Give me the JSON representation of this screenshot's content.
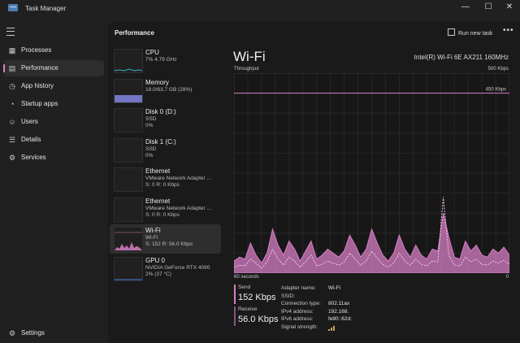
{
  "window": {
    "title": "Task Manager",
    "controls": [
      "—",
      "☐",
      "✕"
    ]
  },
  "nav": {
    "items": [
      {
        "label": "Processes",
        "icon": "processes-icon",
        "glyph": "▦",
        "active": false
      },
      {
        "label": "Performance",
        "icon": "performance-icon",
        "glyph": "▤",
        "active": true
      },
      {
        "label": "App history",
        "icon": "app-history-icon",
        "glyph": "◷",
        "active": false
      },
      {
        "label": "Startup apps",
        "icon": "startup-apps-icon",
        "glyph": "◔",
        "active": false
      },
      {
        "label": "Users",
        "icon": "users-icon",
        "glyph": "☺",
        "active": false
      },
      {
        "label": "Details",
        "icon": "details-icon",
        "glyph": "☰",
        "active": false
      },
      {
        "label": "Services",
        "icon": "services-icon",
        "glyph": "⚙",
        "active": false
      }
    ],
    "settings": {
      "label": "Settings",
      "glyph": "⚙"
    }
  },
  "performance": {
    "title": "Performance",
    "run_new_task": "Run new task",
    "more": "•••",
    "devices": [
      {
        "name": "CPU",
        "sub1": "7% 4.79 GHz",
        "sub2": "",
        "sub3": "",
        "thumb_color": "#2fb3c4",
        "active": false
      },
      {
        "name": "Memory",
        "sub1": "18.0/63.7 GB (28%)",
        "sub2": "",
        "sub3": "",
        "thumb_color": "#7d7fd6",
        "active": false
      },
      {
        "name": "Disk 0 (D:)",
        "sub1": "SSD",
        "sub2": "0%",
        "sub3": "",
        "thumb_color": "#68b04a",
        "active": false
      },
      {
        "name": "Disk 1 (C:)",
        "sub1": "SSD",
        "sub2": "0%",
        "sub3": "",
        "thumb_color": "#68b04a",
        "active": false
      },
      {
        "name": "Ethernet",
        "sub1": "VMware Network Adapter ...",
        "sub2": "S: 0 R: 0 Kbps",
        "sub3": "",
        "thumb_color": "#c88a2d",
        "active": false
      },
      {
        "name": "Ethernet",
        "sub1": "VMware Network Adapter ...",
        "sub2": "S: 0 R: 0 Kbps",
        "sub3": "",
        "thumb_color": "#c88a2d",
        "active": false
      },
      {
        "name": "Wi-Fi",
        "sub1": "Wi-Fi",
        "sub2": "S: 152 R: 56.0 Kbps",
        "sub3": "",
        "thumb_color": "#d77fc6",
        "active": true
      },
      {
        "name": "GPU 0",
        "sub1": "NVIDIA GeForce RTX 4090",
        "sub2": "2% (37 °C)",
        "sub3": "",
        "thumb_color": "#3f7fd0",
        "active": false
      }
    ]
  },
  "graph": {
    "title": "Wi-Fi",
    "adapter": "Intel(R) Wi-Fi 6E AX211 160MHz",
    "throughput_label": "Throughput",
    "max_label": "500 Kbps",
    "line_label": "450 Kbps",
    "line_value": 450,
    "max_value": 500,
    "time_left": "60 seconds",
    "time_right": "0",
    "color": "#d77fc6",
    "send_series": [
      30,
      40,
      35,
      75,
      45,
      25,
      50,
      110,
      70,
      45,
      80,
      60,
      30,
      55,
      80,
      35,
      45,
      60,
      50,
      40,
      55,
      95,
      70,
      40,
      60,
      110,
      75,
      45,
      30,
      50,
      95,
      60,
      40,
      70,
      45,
      35,
      60,
      55,
      150,
      90,
      40,
      35,
      80,
      55,
      70,
      45,
      40,
      60,
      50,
      65,
      45
    ],
    "receive_series": [
      15,
      20,
      18,
      35,
      25,
      12,
      28,
      60,
      35,
      20,
      40,
      30,
      15,
      28,
      45,
      18,
      22,
      30,
      25,
      20,
      28,
      50,
      35,
      20,
      30,
      55,
      38,
      22,
      15,
      25,
      50,
      30,
      20,
      35,
      22,
      18,
      30,
      28,
      190,
      45,
      20,
      18,
      40,
      28,
      35,
      22,
      20,
      30,
      25,
      32,
      22
    ]
  },
  "stats": {
    "send_label": "Send",
    "send_value": "152 Kbps",
    "receive_label": "Receive",
    "receive_value": "56.0 Kbps",
    "properties": [
      {
        "label": "Adapter name:",
        "value": "Wi-Fi"
      },
      {
        "label": "SSID:",
        "value": ""
      },
      {
        "label": "Connection type:",
        "value": "802.11ax"
      },
      {
        "label": "IPv4 address:",
        "value": "192.168."
      },
      {
        "label": "IPv6 address:",
        "value": "fe80::62d:"
      },
      {
        "label": "Signal strength:",
        "value": ""
      }
    ]
  }
}
